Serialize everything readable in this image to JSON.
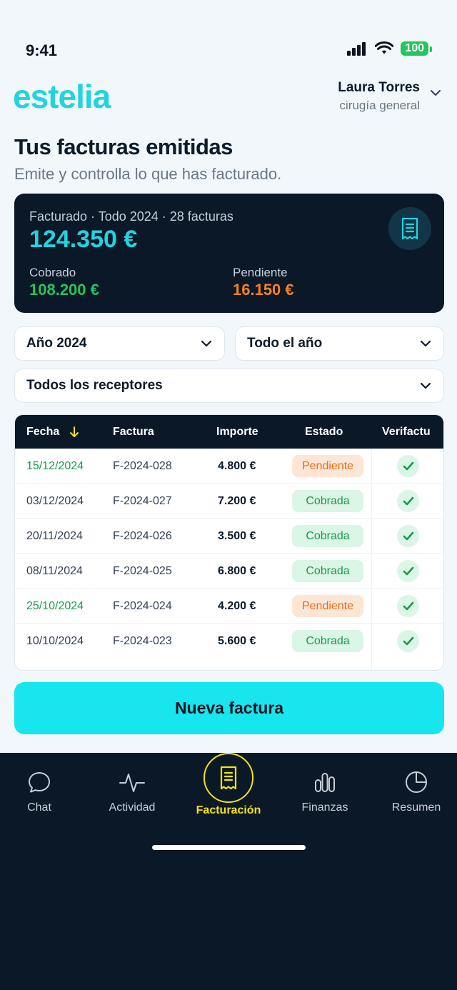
{
  "status_bar": {
    "time": "9:41",
    "battery": "100"
  },
  "header": {
    "brand": "estelia",
    "user_name": "Laura Torres",
    "user_role": "cirugía general"
  },
  "page": {
    "title": "Tus facturas emitidas",
    "subtitle": "Emite y controlla lo que has facturado."
  },
  "summary": {
    "caption": "Facturado · Todo 2024 · 28 facturas",
    "total": "124.350 €",
    "paid_label": "Cobrado",
    "paid_value": "108.200 €",
    "pending_label": "Pendiente",
    "pending_value": "16.150 €"
  },
  "filters": {
    "year": "Año 2024",
    "period": "Todo el año",
    "receivers": "Todos los receptores"
  },
  "table": {
    "headers": {
      "date": "Fecha",
      "invoice": "Factura",
      "amount": "Importe",
      "status": "Estado",
      "verifactu": "Verifactu"
    },
    "rows": [
      {
        "date": "15/12/2024",
        "invoice": "F-2024-028",
        "amount": "4.800 €",
        "status": "Pendiente"
      },
      {
        "date": "03/12/2024",
        "invoice": "F-2024-027",
        "amount": "7.200 €",
        "status": "Cobrada"
      },
      {
        "date": "20/11/2024",
        "invoice": "F-2024-026",
        "amount": "3.500 €",
        "status": "Cobrada"
      },
      {
        "date": "08/11/2024",
        "invoice": "F-2024-025",
        "amount": "6.800 €",
        "status": "Cobrada"
      },
      {
        "date": "25/10/2024",
        "invoice": "F-2024-024",
        "amount": "4.200 €",
        "status": "Pendiente"
      },
      {
        "date": "10/10/2024",
        "invoice": "F-2024-023",
        "amount": "5.600 €",
        "status": "Cobrada"
      }
    ]
  },
  "cta": {
    "label": "Nueva factura"
  },
  "nav": {
    "chat": "Chat",
    "activity": "Actividad",
    "billing": "Facturación",
    "finance": "Finanzas",
    "summary": "Resumen"
  },
  "colors": {
    "brand": "#22d3e0",
    "dark": "#0b1828",
    "paid": "#22c55e",
    "pending": "#f5821f",
    "active_nav": "#f5e30a",
    "cta": "#17e6ef"
  }
}
